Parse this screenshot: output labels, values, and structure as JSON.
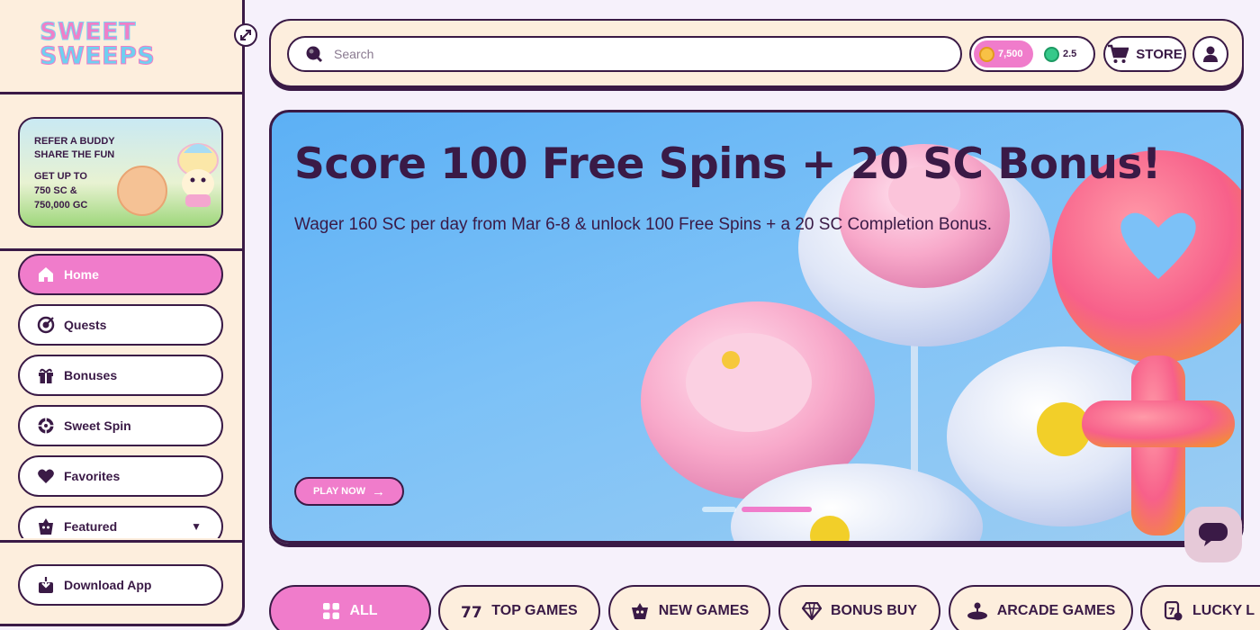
{
  "brand": {
    "line1": "SWEET",
    "line2": "SWEEPS"
  },
  "promo_card": {
    "line1": "REFER A BUDDY",
    "line2": "SHARE THE FUN",
    "line3": "GET UP TO",
    "line4": "750 SC &",
    "line5": "750,000 GC"
  },
  "sidebar": {
    "items": [
      {
        "label": "Home",
        "icon": "home-icon",
        "active": true
      },
      {
        "label": "Quests",
        "icon": "quests-icon"
      },
      {
        "label": "Bonuses",
        "icon": "gift-icon"
      },
      {
        "label": "Sweet Spin",
        "icon": "wheel-icon"
      },
      {
        "label": "Favorites",
        "icon": "heart-icon"
      },
      {
        "label": "Featured",
        "icon": "featured-icon"
      }
    ],
    "download_label": "Download App"
  },
  "header": {
    "search_placeholder": "Search",
    "gold_coins": "7,500",
    "sweeps_coins": "2.5",
    "store_label": "STORE"
  },
  "banner": {
    "title": "Score 100 Free Spins + 20 SC Bonus!",
    "subtitle": "Wager 160 SC per day from Mar 6-8 & unlock 100 Free Spins + a 20 SC Completion Bonus.",
    "cta": "PLAY NOW"
  },
  "categories": [
    {
      "label": "ALL",
      "icon": "grid-icon",
      "active": true
    },
    {
      "label": "TOP GAMES",
      "icon": "sevens-icon"
    },
    {
      "label": "NEW GAMES",
      "icon": "new-icon"
    },
    {
      "label": "BONUS BUY",
      "icon": "diamond-icon"
    },
    {
      "label": "ARCADE GAMES",
      "icon": "joystick-icon"
    },
    {
      "label": "LUCKY L",
      "icon": "lucky-icon"
    }
  ],
  "colors": {
    "accent": "#f07ccb",
    "ink": "#3a1a46",
    "panel": "#fdeedd",
    "banner_sky": "#5cb0f5"
  }
}
